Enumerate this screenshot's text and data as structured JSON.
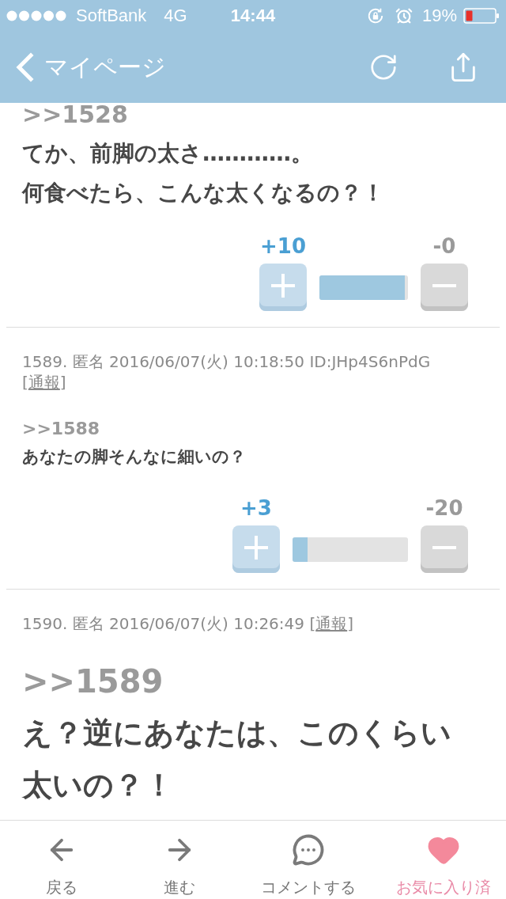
{
  "status_bar": {
    "carrier": "SoftBank",
    "network": "4G",
    "time": "14:44",
    "battery": "19%"
  },
  "nav": {
    "back_label": "マイページ"
  },
  "comments": [
    {
      "kind": "medium",
      "quote": ">>1528",
      "body": [
        "てか、前脚の太さ…………。",
        "何食べたら、こんな太くなるの？！"
      ],
      "vote": {
        "up": "+10",
        "down": "-0",
        "level": 0.96
      }
    },
    {
      "kind": "small",
      "meta": "1589. 匿名 2016/06/07(火) 10:18:50 ID:JHp4S6nPdG",
      "report": {
        "open": "[",
        "label": "通報",
        "close": "]"
      },
      "quote": ">>1588",
      "body": [
        "あなたの脚そんなに細いの？"
      ],
      "vote": {
        "up": "+3",
        "down": "-20",
        "level": 0.13
      }
    },
    {
      "kind": "large",
      "meta": "1590. 匿名 2016/06/07(火) 10:26:49",
      "report": {
        "open": "[",
        "label": "通報",
        "close": "]"
      },
      "quote": ">>1589",
      "body": [
        "え？逆にあなたは、このくらい",
        "太いの？！"
      ]
    }
  ],
  "tab_bar": [
    {
      "kind": "back",
      "label": "戻る",
      "active": false
    },
    {
      "kind": "forward",
      "label": "進む",
      "active": false
    },
    {
      "kind": "comment",
      "label": "コメントする",
      "active": false
    },
    {
      "kind": "favorite",
      "label": "お気に入り済",
      "active": true
    }
  ]
}
